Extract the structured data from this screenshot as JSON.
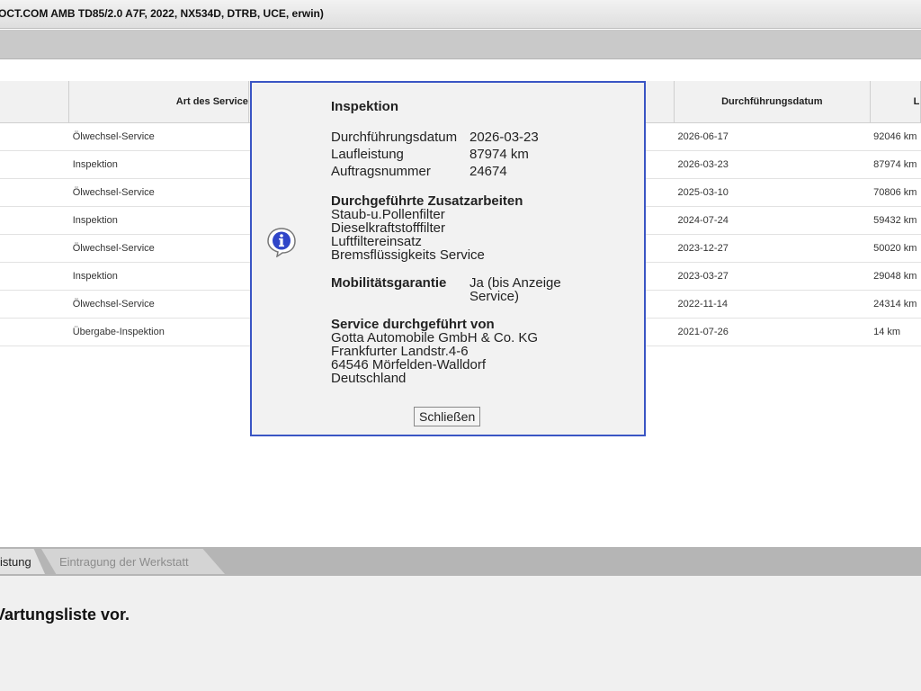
{
  "window": {
    "title": "OCT.COM AMB TD85/2.0 A7F, 2022, NX534D, DTRB, UCE, erwin)"
  },
  "table": {
    "columns": [
      "",
      "Art des Service",
      "",
      "Durchführungsdatum",
      "L"
    ],
    "rows": [
      {
        "type": "Ölwechsel-Service",
        "date": "2026-06-17",
        "km": "92046 km"
      },
      {
        "type": "Inspektion",
        "date": "2026-03-23",
        "km": "87974 km"
      },
      {
        "type": "Ölwechsel-Service",
        "date": "2025-03-10",
        "km": "70806 km"
      },
      {
        "type": "Inspektion",
        "date": "2024-07-24",
        "km": "59432 km"
      },
      {
        "type": "Ölwechsel-Service",
        "date": "2023-12-27",
        "km": "50020 km"
      },
      {
        "type": "Inspektion",
        "date": "2023-03-27",
        "km": "29048 km"
      },
      {
        "type": "Ölwechsel-Service",
        "date": "2022-11-14",
        "km": "24314 km"
      },
      {
        "type": "Übergabe-Inspektion",
        "date": "2021-07-26",
        "km": "14 km"
      }
    ]
  },
  "tabs": [
    {
      "label": "istung",
      "active": true
    },
    {
      "label": "Eintragung der Werkstatt",
      "active": false
    }
  ],
  "lower_panel": {
    "message": "Vartungsliste vor."
  },
  "dialog": {
    "title": "Inspektion",
    "icon": "info-icon",
    "fields": [
      {
        "label": "Durchführungsdatum",
        "value": "2026-03-23"
      },
      {
        "label": "Laufleistung",
        "value": "87974 km"
      },
      {
        "label": "Auftragsnummer",
        "value": "24674"
      }
    ],
    "extra_work_title": "Durchgeführte Zusatzarbeiten",
    "extra_work": [
      "Staub-u.Pollenfilter",
      "Dieselkraftstofffilter",
      "Luftfiltereinsatz",
      "Bremsflüssigkeits Service"
    ],
    "mobility_label": "Mobilitätsgarantie",
    "mobility_value_line1": "Ja (bis Anzeige",
    "mobility_value_line2": "Service)",
    "performed_by_title": "Service durchgeführt von",
    "performed_by": [
      "Gotta Automobile GmbH & Co. KG",
      "Frankfurter Landstr.4-6",
      "64546 Mörfelden-Walldorf",
      "Deutschland"
    ],
    "close_label": "Schließen"
  }
}
